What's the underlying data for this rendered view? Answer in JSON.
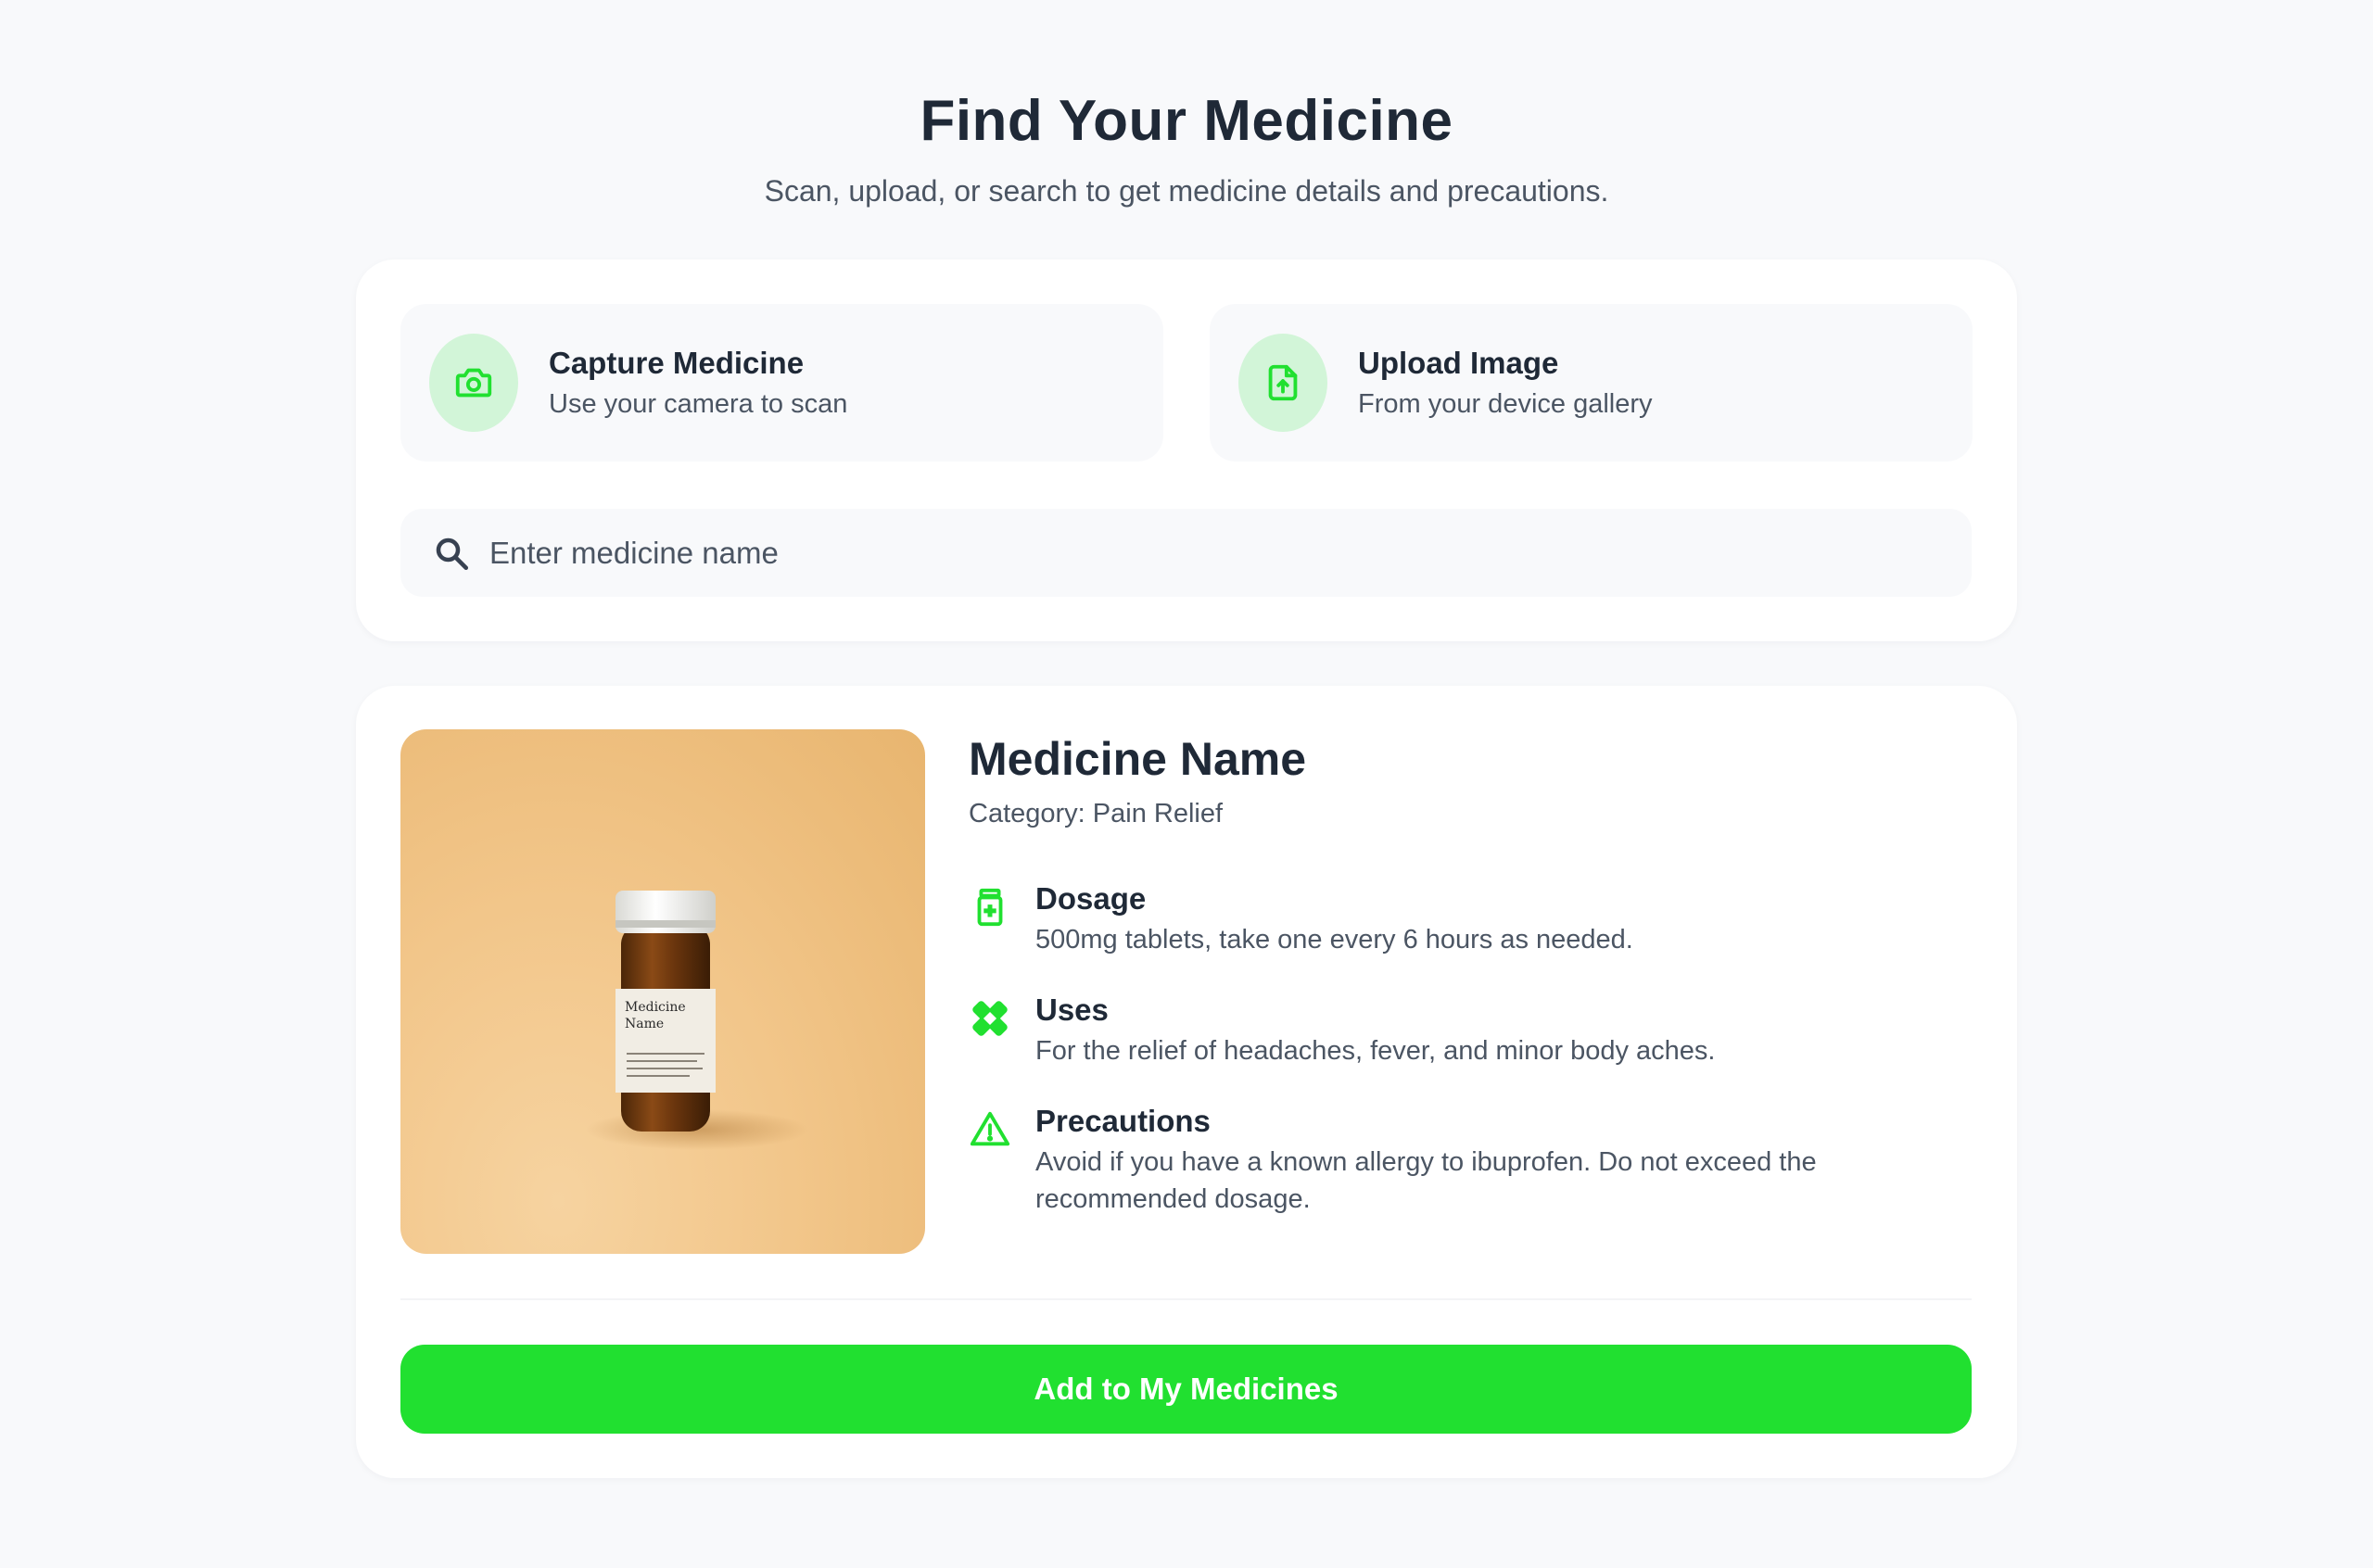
{
  "header": {
    "title": "Find Your Medicine",
    "subtitle": "Scan, upload, or search to get medicine details and precautions."
  },
  "actions": [
    {
      "title": "Capture Medicine",
      "description": "Use your camera to scan",
      "icon": "camera-icon"
    },
    {
      "title": "Upload Image",
      "description": "From your device gallery",
      "icon": "file-upload-icon"
    }
  ],
  "search": {
    "placeholder": "Enter medicine name",
    "value": "",
    "icon": "search-icon"
  },
  "result": {
    "image_label": {
      "line1": "Medicine",
      "line2": "Name"
    },
    "name": "Medicine Name",
    "category": "Category: Pain Relief",
    "details": [
      {
        "title": "Dosage",
        "text": "500mg tablets, take one every 6 hours as needed.",
        "icon": "medicine-bottle-icon"
      },
      {
        "title": "Uses",
        "text": "For the relief of headaches, fever, and minor body aches.",
        "icon": "bandage-icon"
      },
      {
        "title": "Precautions",
        "text": "Avoid if you have a known allergy to ibuprofen. Do not exceed the recommended dosage.",
        "icon": "warning-icon"
      }
    ],
    "button_label": "Add to My Medicines"
  },
  "colors": {
    "accent": "#21e030",
    "accent_soft": "#d2f5d8",
    "background": "#f8f9fb",
    "card": "#ffffff",
    "text_primary": "#1f2937",
    "text_secondary": "#4b5563"
  }
}
